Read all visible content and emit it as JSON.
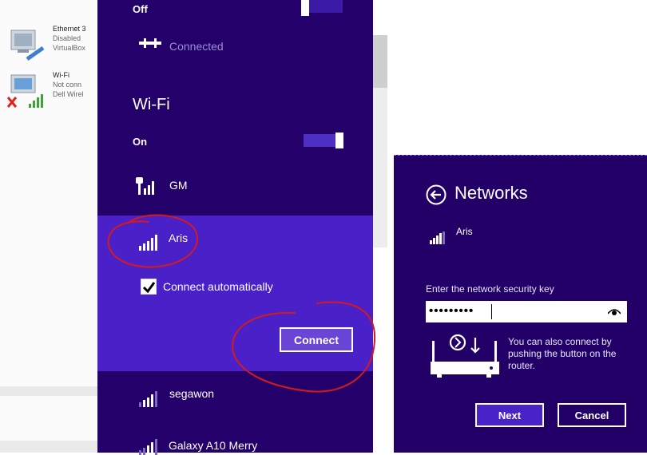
{
  "background_window": {
    "items": [
      {
        "name": "Ethernet 3",
        "status": "Disabled",
        "detail": "VirtualBox"
      },
      {
        "name": "Wi-Fi",
        "status": "Not conn",
        "detail": "Dell Wirel"
      }
    ]
  },
  "flyout": {
    "top_toggle_label": "Off",
    "ethernet_status": "Connected",
    "wifi_heading": "Wi-Fi",
    "wifi_toggle_label": "On",
    "networks": [
      {
        "name": "GM",
        "secured": true
      },
      {
        "name": "Aris",
        "secured": false
      },
      {
        "name": "segawon",
        "secured": false
      },
      {
        "name": "Galaxy A10 Merry",
        "secured": false
      }
    ],
    "connect_automatically_label": "Connect automatically",
    "connect_automatically_checked": true,
    "connect_button_label": "Connect"
  },
  "dialog": {
    "title": "Networks",
    "network_name": "Aris",
    "key_label": "Enter the network security key",
    "key_value": "•••••••••",
    "wps_text": "You can also connect by pushing the button on the router.",
    "next_label": "Next",
    "cancel_label": "Cancel"
  },
  "colors": {
    "flyout_bg": "#24006b",
    "selected_bg": "#4a20c8",
    "dialog_bg": "#220067",
    "annotation": "#d7191c"
  }
}
